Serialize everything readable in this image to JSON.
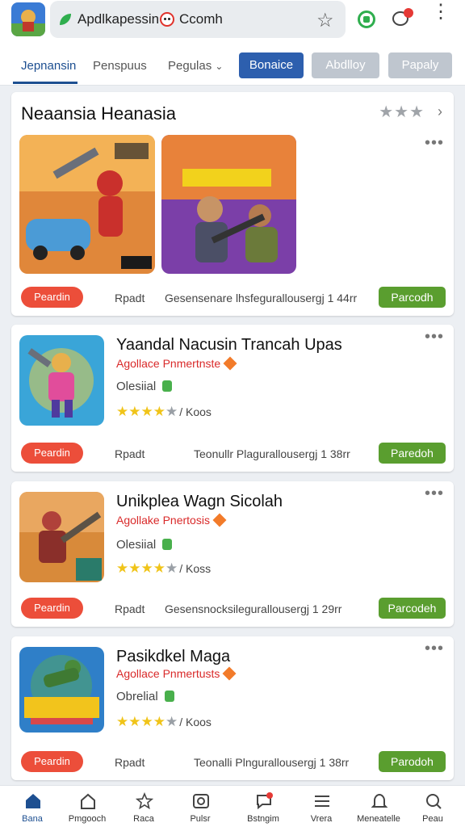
{
  "topbar": {
    "address_text_1": "Apdlkapessin",
    "address_text_2": "Ccomh"
  },
  "tabs": {
    "items": [
      "Jepnansin",
      "Penspuus",
      "Pegulas"
    ],
    "chips": [
      "Bonaice",
      "Abdlloy",
      "Papaly"
    ]
  },
  "cards": [
    {
      "title": "Neaansia Heanasia",
      "red_button": "Peardin",
      "meta_left": "Rpadt",
      "meta_right": "Gesensenare lhsfegurallousergj 1 44rr",
      "green_button": "Parcodh"
    },
    {
      "name": "Yaandal Nacusin Trancah Upas",
      "developer": "Agollace Pnmertnste",
      "official": "Olesiial",
      "rating_text": "/ Koos",
      "red_button": "Peardin",
      "meta_left": "Rpadt",
      "meta_right": "Teonullr Plagurallousergj 1 38rr",
      "green_button": "Paredoh"
    },
    {
      "name": "Unikplea Wagn Sicolah",
      "developer": "Agollake Pnertosis",
      "official": "Olesiial",
      "rating_text": "/ Koss",
      "red_button": "Peardin",
      "meta_left": "Rpadt",
      "meta_right": "Gesensnocksilegurallousergj 1 29rr",
      "green_button": "Parcodeh"
    },
    {
      "name": "Pasikdkel Maga",
      "developer": "Agollace Pnmertusts",
      "official": "Obrelial",
      "rating_text": "/ Koos",
      "red_button": "Peardin",
      "meta_left": "Rpadt",
      "meta_right": "Teonalli Plngurallousergj 1 38rr",
      "green_button": "Parodoh"
    }
  ],
  "bottom_nav": [
    {
      "label": "Bana",
      "icon": "home-icon"
    },
    {
      "label": "Pmgooch",
      "icon": "house-outline-icon"
    },
    {
      "label": "Raca",
      "icon": "star-icon"
    },
    {
      "label": "Pulsr",
      "icon": "camera-icon"
    },
    {
      "label": "Bstngim",
      "icon": "chat-icon"
    },
    {
      "label": "Vrera",
      "icon": "list-icon"
    },
    {
      "label": "Meneatelle",
      "icon": "bell-icon"
    },
    {
      "label": "Peau",
      "icon": "search-icon"
    }
  ],
  "colors": {
    "accent_blue": "#2d5fae",
    "red_pill": "#ec4e3a",
    "green_button": "#5a9e2f",
    "developer_red": "#d92a2a"
  }
}
